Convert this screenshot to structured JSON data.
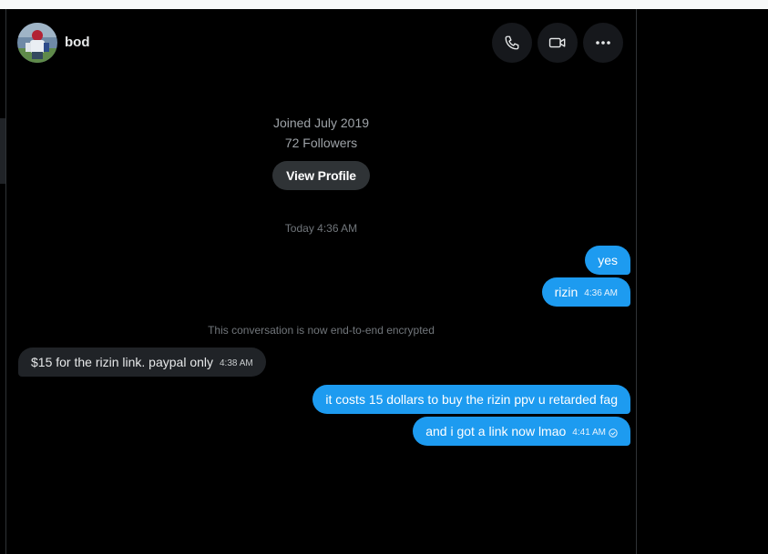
{
  "header": {
    "name": "bod",
    "call_icon": "phone-icon",
    "video_icon": "video-camera-icon",
    "more_icon": "more-horizontal-icon"
  },
  "profile": {
    "joined": "Joined July 2019",
    "followers": "72 Followers",
    "view_profile_label": "View Profile"
  },
  "conversation": {
    "date_divider": "Today 4:36 AM",
    "encryption_notice": "This conversation is now end-to-end encrypted",
    "messages": [
      {
        "text": "yes",
        "time": "",
        "direction": "outgoing"
      },
      {
        "text": "rizin",
        "time": "4:36 AM",
        "direction": "outgoing"
      },
      {
        "text": "$15 for the rizin link. paypal only",
        "time": "4:38 AM",
        "direction": "incoming"
      },
      {
        "text": "it costs 15 dollars to buy the rizin ppv u retarded fag",
        "time": "",
        "direction": "outgoing"
      },
      {
        "text": "and i got a link now lmao",
        "time": "4:41 AM",
        "direction": "outgoing",
        "status_icon": "read-check-icon"
      }
    ]
  },
  "colors": {
    "background": "#000000",
    "outgoing_bubble": "#1d9bf0",
    "incoming_bubble": "#202327",
    "muted_text": "#71767b"
  }
}
